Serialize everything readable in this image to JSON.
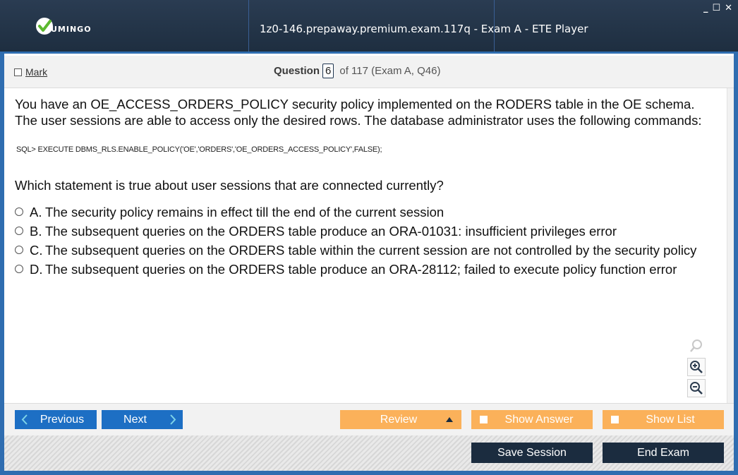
{
  "app": {
    "logo_text": "UMINGO",
    "title": "1z0-146.prepaway.premium.exam.117q - Exam A - ETE Player",
    "window_controls": {
      "minimize": "_",
      "maximize": "☐",
      "close": "✕"
    }
  },
  "header": {
    "mark_label": "Mark",
    "question_word": "Question",
    "question_number": "6",
    "question_of": "of 117 (Exam A, Q46)"
  },
  "question": {
    "text": "You have an OE_ACCESS_ORDERS_POLICY security policy implemented on the RODERS table in the OE schema. The user sessions are able to access only the desired rows. The database administrator uses the following commands:",
    "sql": "SQL> EXECUTE DBMS_RLS.ENABLE_POLICY('OE','ORDERS','OE_ORDERS_ACCESS_POLICY',FALSE);",
    "statement": "Which statement is true about user sessions that are connected currently?",
    "options": [
      {
        "letter": "A.",
        "text": "The security policy remains in effect till the end of the current session"
      },
      {
        "letter": "B.",
        "text": "The subsequent queries on the ORDERS table produce an ORA-01031: insufficient privileges error"
      },
      {
        "letter": "C.",
        "text": "The subsequent queries on the ORDERS table within the current session are not controlled by the security policy"
      },
      {
        "letter": "D.",
        "text": "The subsequent queries on the ORDERS table produce an ORA-28112; failed to execute policy function error"
      }
    ]
  },
  "zoom": {
    "icons": [
      "magnifier-icon",
      "zoom-in-icon",
      "zoom-out-icon"
    ]
  },
  "nav": {
    "previous_label": "Previous",
    "next_label": "Next",
    "review_label": "Review",
    "show_answer_label": "Show Answer",
    "show_list_label": "Show List"
  },
  "footer": {
    "save_session_label": "Save Session",
    "end_exam_label": "End Exam"
  },
  "colors": {
    "titlebar": "#1e2e40",
    "accent_blue": "#2f6db0",
    "nav_blue": "#1d6fc4",
    "orange": "#fbb15a",
    "dark_button": "#1b2c3f"
  }
}
